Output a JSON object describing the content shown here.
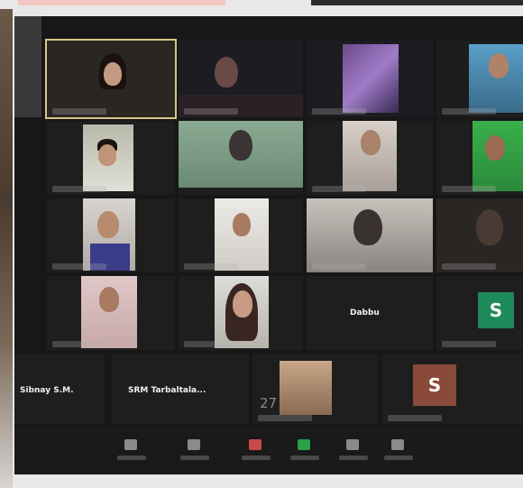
{
  "meeting": {
    "participant_count": "27",
    "name_tiles": [
      {
        "label": "Dabbu"
      },
      {
        "label": "Sibnay S.M."
      },
      {
        "label": "SRM Tarbaltala..."
      }
    ],
    "avatars": [
      {
        "letter": "S",
        "color": "#1e8a5a"
      },
      {
        "letter": "S",
        "color": "#8a4a3a"
      }
    ]
  },
  "colors": {
    "screen_bg": "#171717",
    "tile_bg": "#1e1e1e",
    "active_speaker_border": "#d7c58a",
    "video_button": "#2aa14a"
  },
  "toolbar": {
    "buttons": [
      {
        "name": "search-icon"
      },
      {
        "name": "participants-icon"
      },
      {
        "name": "microphone-icon"
      },
      {
        "name": "video-camera-icon"
      },
      {
        "name": "share-screen-icon"
      },
      {
        "name": "leave-icon"
      }
    ]
  }
}
